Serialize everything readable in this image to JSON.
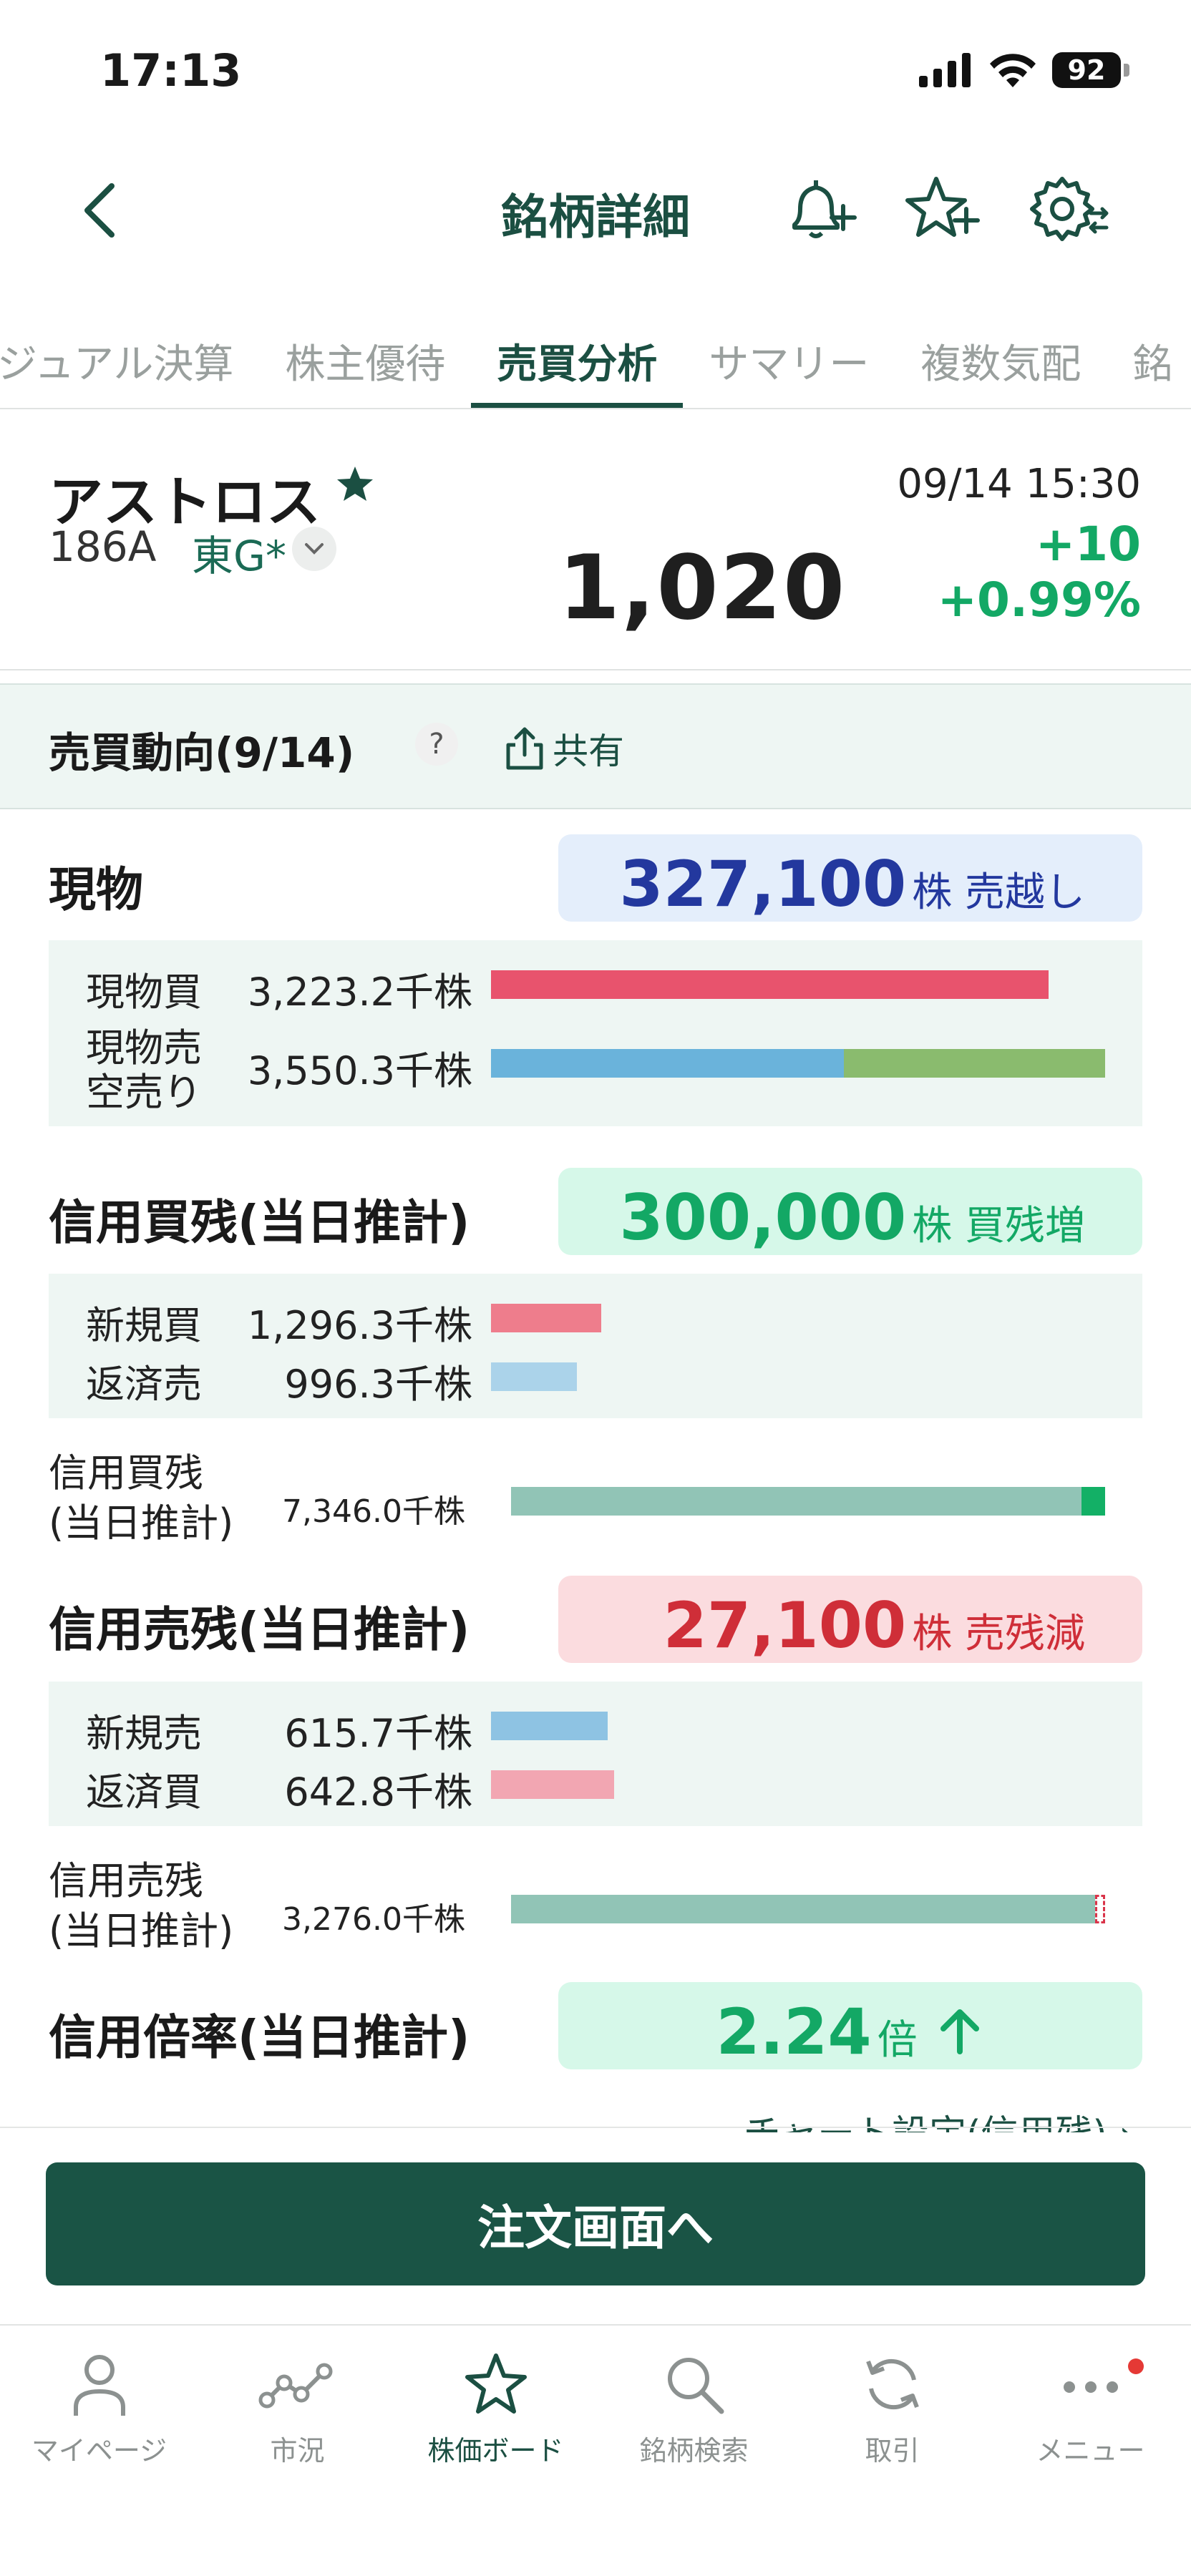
{
  "status_bar": {
    "time": "17:13",
    "battery": "92"
  },
  "header": {
    "title": "銘柄詳細"
  },
  "tabs": [
    {
      "label": "ジュアル決算"
    },
    {
      "label": "株主優待"
    },
    {
      "label": "売買分析",
      "active": true
    },
    {
      "label": "サマリー"
    },
    {
      "label": "複数気配"
    },
    {
      "label": "銘"
    }
  ],
  "stock": {
    "name": "アストロス",
    "code": "186A",
    "market": "東G*",
    "datetime": "09/14 15:30",
    "price": "1,020",
    "change": "+10",
    "change_pct": "+0.99%"
  },
  "section": {
    "title": "売買動向(9/14)",
    "help": "?",
    "share": "共有"
  },
  "genbutsu": {
    "title": "現物",
    "total": "327,100",
    "total_unit": "株 売越し",
    "buy_label": "現物買",
    "buy_value": "3,223.2千株",
    "buy_ratio": 0.908,
    "sell_label_1": "現物売",
    "sell_label_2": "空売り",
    "sell_value": "3,550.3千株",
    "sell_ratio_plain": 0.575,
    "sell_ratio_short": 0.425
  },
  "margin_buy": {
    "title": "信用買残(当日推計)",
    "total": "300,000",
    "total_unit": "株 買残増",
    "new_label": "新規買",
    "new_value": "1,296.3千株",
    "new_ratio": 0.18,
    "repay_label": "返済売",
    "repay_value": "996.3千株",
    "repay_ratio": 0.14,
    "balance_label_1": "信用買残",
    "balance_label_2": "(当日推計)",
    "balance_value": "7,346.0千株",
    "balance_increase_ratio": 0.04
  },
  "margin_sell": {
    "title": "信用売残(当日推計)",
    "total": "27,100",
    "total_unit": "株 売残減",
    "new_label": "新規売",
    "new_value": "615.7千株",
    "new_ratio": 0.19,
    "repay_label": "返済買",
    "repay_value": "642.8千株",
    "repay_ratio": 0.2,
    "balance_label_1": "信用売残",
    "balance_label_2": "(当日推計)",
    "balance_value": "3,276.0千株",
    "balance_decrease_ratio": 0.008
  },
  "margin_ratio": {
    "title": "信用倍率(当日推計)",
    "value": "2.24",
    "unit": "倍"
  },
  "chart_link": "チャート設定(信用残)",
  "order_button": "注文画面へ",
  "nav": [
    {
      "label": "マイページ",
      "icon": "person-icon"
    },
    {
      "label": "市況",
      "icon": "market-icon"
    },
    {
      "label": "株価ボード",
      "icon": "star-icon",
      "active": true
    },
    {
      "label": "銘柄検索",
      "icon": "search-icon"
    },
    {
      "label": "取引",
      "icon": "refresh-icon"
    },
    {
      "label": "メニュー",
      "icon": "more-icon"
    }
  ],
  "colors": {
    "brand": "#1b4f42",
    "up_green": "#13a865",
    "buy_red": "#e8536d",
    "sell_blue": "#6ab3db",
    "short_green": "#8abb6e",
    "balance_teal": "#91c4b6"
  }
}
